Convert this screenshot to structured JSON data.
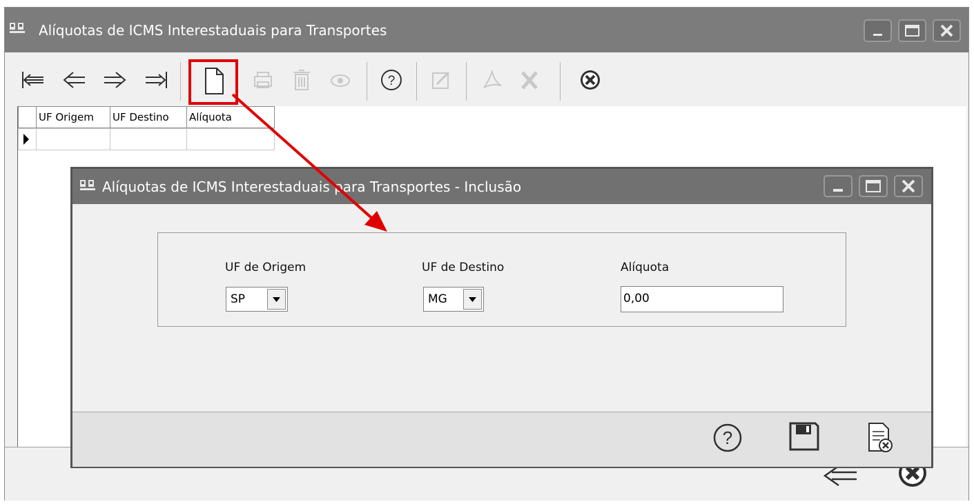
{
  "main_window": {
    "title": "Alíquotas de ICMS Interestaduais para Transportes",
    "toolbar": [
      {
        "name": "first-record-icon",
        "enabled": true
      },
      {
        "name": "previous-record-icon",
        "enabled": true
      },
      {
        "name": "next-record-icon",
        "enabled": true
      },
      {
        "name": "last-record-icon",
        "enabled": true
      },
      {
        "name": "new-record-icon",
        "enabled": true,
        "highlighted": true
      },
      {
        "name": "print-icon",
        "enabled": false
      },
      {
        "name": "delete-icon",
        "enabled": false
      },
      {
        "name": "view-icon",
        "enabled": false
      },
      {
        "name": "help-icon",
        "enabled": true
      },
      {
        "name": "edit-icon",
        "enabled": false
      },
      {
        "name": "pdf-icon",
        "enabled": false
      },
      {
        "name": "excel-icon",
        "enabled": false
      },
      {
        "name": "close-icon",
        "enabled": true
      }
    ],
    "grid": {
      "columns": [
        "UF Origem",
        "UF Destino",
        "Alíquota"
      ],
      "rows": [
        [
          "",
          "",
          ""
        ]
      ]
    }
  },
  "dialog": {
    "title": "Alíquotas de ICMS Interestaduais para Transportes - Inclusão",
    "fields": {
      "uf_origem": {
        "label": "UF de Origem",
        "value": "SP"
      },
      "uf_destino": {
        "label": "UF de Destino",
        "value": "MG"
      },
      "aliquota": {
        "label": "Alíquota",
        "value": "0,00"
      }
    },
    "footer_buttons": [
      "help-icon",
      "save-icon",
      "cancel-icon"
    ]
  },
  "colors": {
    "titlebar": "#7c7c7c",
    "window_bg": "#f0f0f0",
    "highlight": "#e00000",
    "icon": "#303030",
    "icon_disabled": "#c8c8c8"
  }
}
